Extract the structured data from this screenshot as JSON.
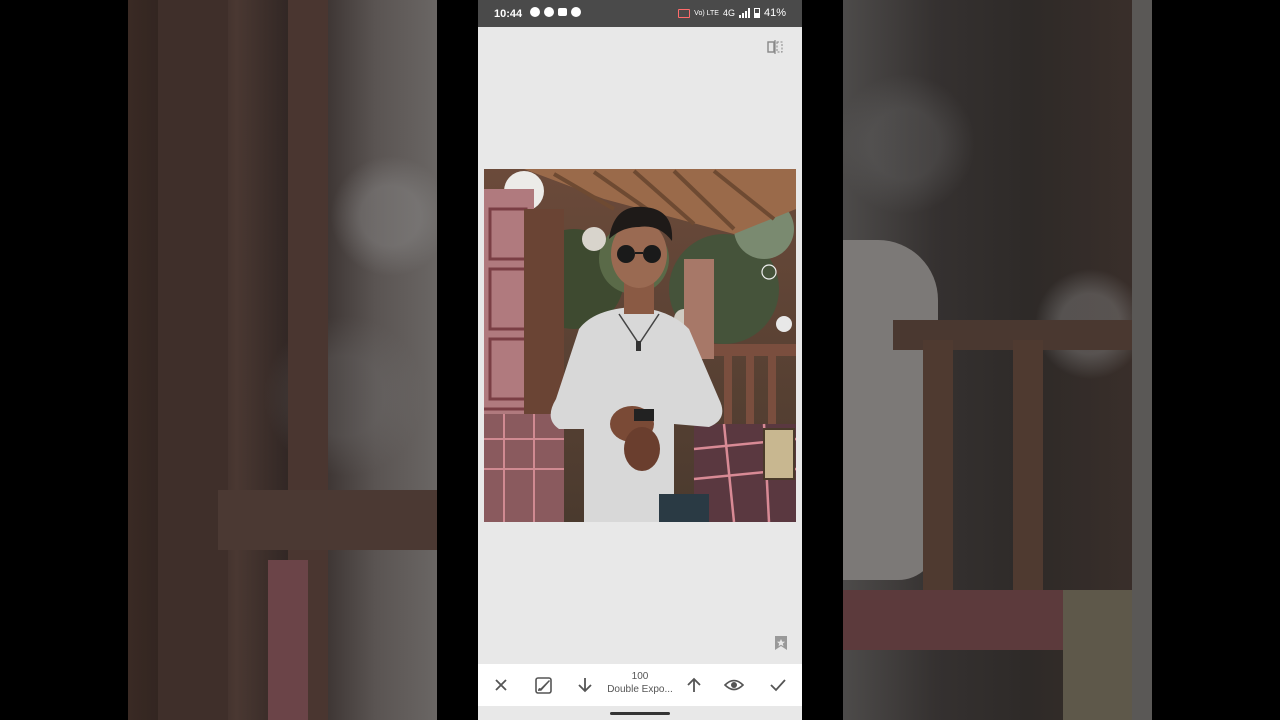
{
  "status_bar": {
    "time": "10:44",
    "network": "4G",
    "volte": "Vo) LTE",
    "battery": "41%"
  },
  "editor": {
    "tool_value": "100",
    "tool_name": "Double Expo..."
  },
  "icons": {
    "close": "close-icon",
    "brush": "brush-icon",
    "down": "arrow-down-icon",
    "up": "arrow-up-icon",
    "eye": "eye-icon",
    "apply": "check-icon",
    "compare": "compare-icon",
    "style": "style-star-icon"
  },
  "colors": {
    "status_bg": "#4a4a4a",
    "canvas_bg": "#e8e8e8",
    "toolbar_bg": "#ffffff",
    "icon": "#555555"
  }
}
